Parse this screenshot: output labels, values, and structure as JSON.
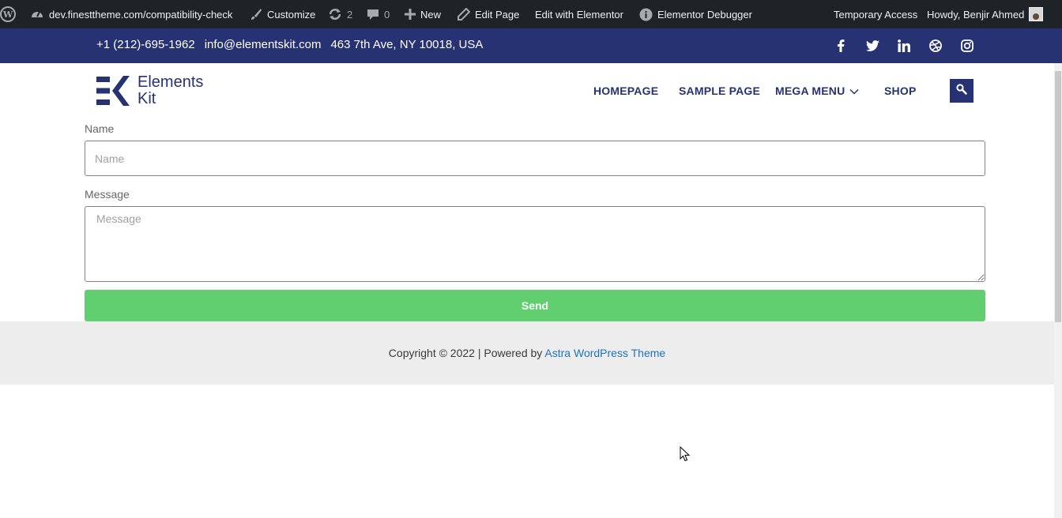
{
  "admin_bar": {
    "site_url": "dev.finesttheme.com/compatibility-check",
    "customize": "Customize",
    "updates_count": "2",
    "comments_count": "0",
    "new": "New",
    "edit_page": "Edit Page",
    "edit_with_elementor": "Edit with Elementor",
    "elementor_debugger": "Elementor Debugger",
    "temporary_access": "Temporary Access",
    "howdy": "Howdy, Benjir Ahmed"
  },
  "top_bar": {
    "phone": "+1 (212)-695-1962",
    "email": "info@elementskit.com",
    "address": "463 7th Ave, NY 10018, USA",
    "social_icons": [
      "facebook-icon",
      "twitter-icon",
      "linkedin-icon",
      "dribbble-icon",
      "instagram-icon"
    ]
  },
  "header": {
    "logo_line1": "Elements",
    "logo_line2": "Kit",
    "nav": {
      "homepage": "HOMEPAGE",
      "sample_page": "SAMPLE PAGE",
      "mega_menu": "MEGA MENU",
      "shop": "SHOP"
    }
  },
  "form": {
    "name_label": "Name",
    "name_placeholder": "Name",
    "message_label": "Message",
    "message_placeholder": "Message",
    "send_label": "Send"
  },
  "footer": {
    "copyright": "Copyright © 2022 | Powered by ",
    "theme_link": "Astra WordPress Theme"
  },
  "colors": {
    "admin_bar_bg": "#1d2327",
    "brand_navy": "#273272",
    "send_green": "#61ce70",
    "footer_bg": "#ededee",
    "link_blue": "#1e73be"
  }
}
